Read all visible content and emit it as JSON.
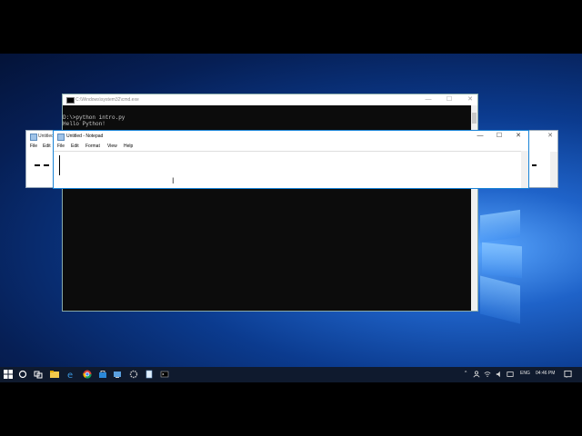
{
  "cmd": {
    "title": "C:\\Windows\\system32\\cmd.exe",
    "lines": [
      "D:\\>python intro.py",
      "Hello Python!"
    ]
  },
  "notepad": {
    "title": "Untitled - Notepad",
    "menu": [
      "File",
      "Edit",
      "Format",
      "View",
      "Help"
    ],
    "text": ""
  },
  "notepad_bg": {
    "title": "Untitled",
    "menu": [
      "File",
      "Edit"
    ]
  },
  "window_controls": {
    "minimize": "—",
    "maximize": "☐",
    "close": "✕"
  },
  "taskbar": {
    "language": "ENG",
    "time": "04:46 PM",
    "icons": [
      "start-icon",
      "search-icon",
      "task-view-icon",
      "file-explorer-icon",
      "edge-icon",
      "chrome-icon",
      "store-icon",
      "network-app-icon",
      "settings-app-icon",
      "notepad-taskbar-icon",
      "cmd-taskbar-icon"
    ]
  },
  "colors": {
    "accent": "#1883d7",
    "console_bg": "#0c0c0c",
    "console_fg": "#cccccc",
    "taskbar": "#0f1a2e"
  }
}
